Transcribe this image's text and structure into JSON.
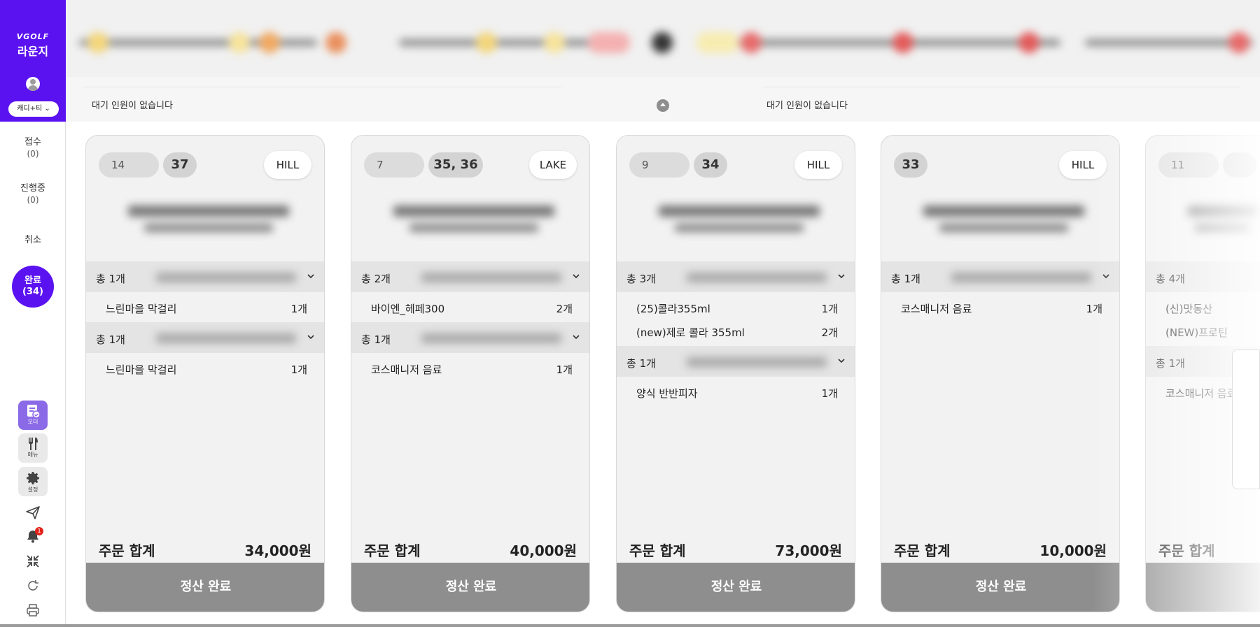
{
  "brand": {
    "logo": "VGOLF",
    "title": "라운지",
    "role_label": "캐디+티 ⌄"
  },
  "nav": [
    {
      "label": "접수",
      "count": "(0)"
    },
    {
      "label": "진행중",
      "count": "(0)"
    },
    {
      "label": "취소",
      "count": ""
    }
  ],
  "nav_active": {
    "label": "완료",
    "count": "(34)"
  },
  "tools": {
    "order": "오더",
    "menu": "메뉴",
    "settings": "설정",
    "notif_badge": "1"
  },
  "waiting": {
    "left": "대기 인원이 없습니다",
    "right": "대기 인원이 없습니다"
  },
  "cards": [
    {
      "num": "14",
      "tee": "37",
      "course": "HILL",
      "groups": [
        {
          "total": "총 1개",
          "items": [
            {
              "name": "느린마을 막걸리",
              "qty": "1개"
            }
          ]
        },
        {
          "total": "총 1개",
          "items": [
            {
              "name": "느린마을 막걸리",
              "qty": "1개"
            }
          ]
        }
      ],
      "total_label": "주문 합계",
      "total_amount": "34,000원",
      "button": "정산 완료"
    },
    {
      "num": "7",
      "tee": "35, 36",
      "course": "LAKE",
      "groups": [
        {
          "total": "총 2개",
          "items": [
            {
              "name": "바이엔_헤페300",
              "qty": "2개"
            }
          ]
        },
        {
          "total": "총 1개",
          "items": [
            {
              "name": "코스매니저 음료",
              "qty": "1개"
            }
          ]
        }
      ],
      "total_label": "주문 합계",
      "total_amount": "40,000원",
      "button": "정산 완료"
    },
    {
      "num": "9",
      "tee": "34",
      "course": "HILL",
      "groups": [
        {
          "total": "총 3개",
          "items": [
            {
              "name": "(25)콜라355ml",
              "qty": "1개"
            },
            {
              "name": "(new)제로 콜라 355ml",
              "qty": "2개"
            }
          ]
        },
        {
          "total": "총 1개",
          "items": [
            {
              "name": "양식 반반피자",
              "qty": "1개"
            }
          ]
        }
      ],
      "total_label": "주문 합계",
      "total_amount": "73,000원",
      "button": "정산 완료"
    },
    {
      "num": "",
      "tee": "33",
      "course": "HILL",
      "groups": [
        {
          "total": "총 1개",
          "items": [
            {
              "name": "코스매니저 음료",
              "qty": "1개"
            }
          ]
        }
      ],
      "total_label": "주문 합계",
      "total_amount": "10,000원",
      "button": "정산 완료"
    },
    {
      "num": "11",
      "tee": "",
      "course": "",
      "groups": [
        {
          "total": "총 4개",
          "items": [
            {
              "name": "(신)맛동산",
              "qty": ""
            },
            {
              "name": "(NEW)프로틴",
              "qty": ""
            }
          ]
        },
        {
          "total": "총 1개",
          "items": [
            {
              "name": "코스매니저 음료",
              "qty": ""
            }
          ]
        }
      ],
      "total_label": "주문 합계",
      "total_amount": "",
      "button": ""
    }
  ]
}
